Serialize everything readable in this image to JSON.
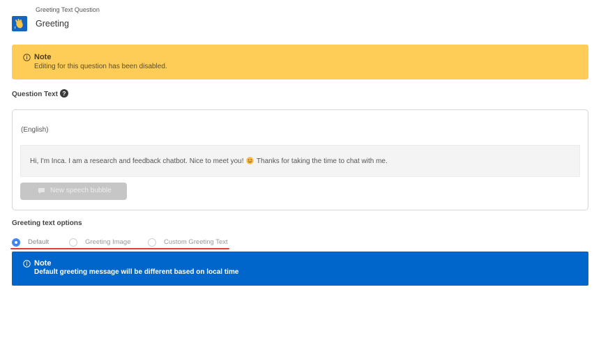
{
  "header": {
    "subtitle": "Greeting Text Question",
    "title": "Greeting",
    "icon": "waving-hand-icon"
  },
  "disabled_note": {
    "title": "Note",
    "text": "Editing for this question has been disabled.",
    "icon": "info-circle-icon",
    "color": "#fecd57"
  },
  "question_text": {
    "label": "Question Text",
    "help_icon": "question-mark-icon",
    "language": "(English)",
    "bubble_text_before": "Hi, I'm Inca. I am a research and feedback chatbot. Nice to meet you!",
    "bubble_emoji": "smiling-face-emoji-icon",
    "bubble_text_after": "Thanks for taking the time to chat with me.",
    "new_bubble_label": "New speech bubble",
    "new_bubble_icon": "speech-bubble-icon"
  },
  "greeting_options": {
    "label": "Greeting text options",
    "options": [
      {
        "label": "Default",
        "selected": true
      },
      {
        "label": "Greeting Image",
        "selected": false
      },
      {
        "label": "Custom Greeting Text",
        "selected": false
      }
    ],
    "annotation_color": "#e23a3a"
  },
  "greeting_note": {
    "title": "Note",
    "text": "Default greeting message will be different based on local time",
    "icon": "info-circle-icon",
    "color": "#0066cc"
  }
}
